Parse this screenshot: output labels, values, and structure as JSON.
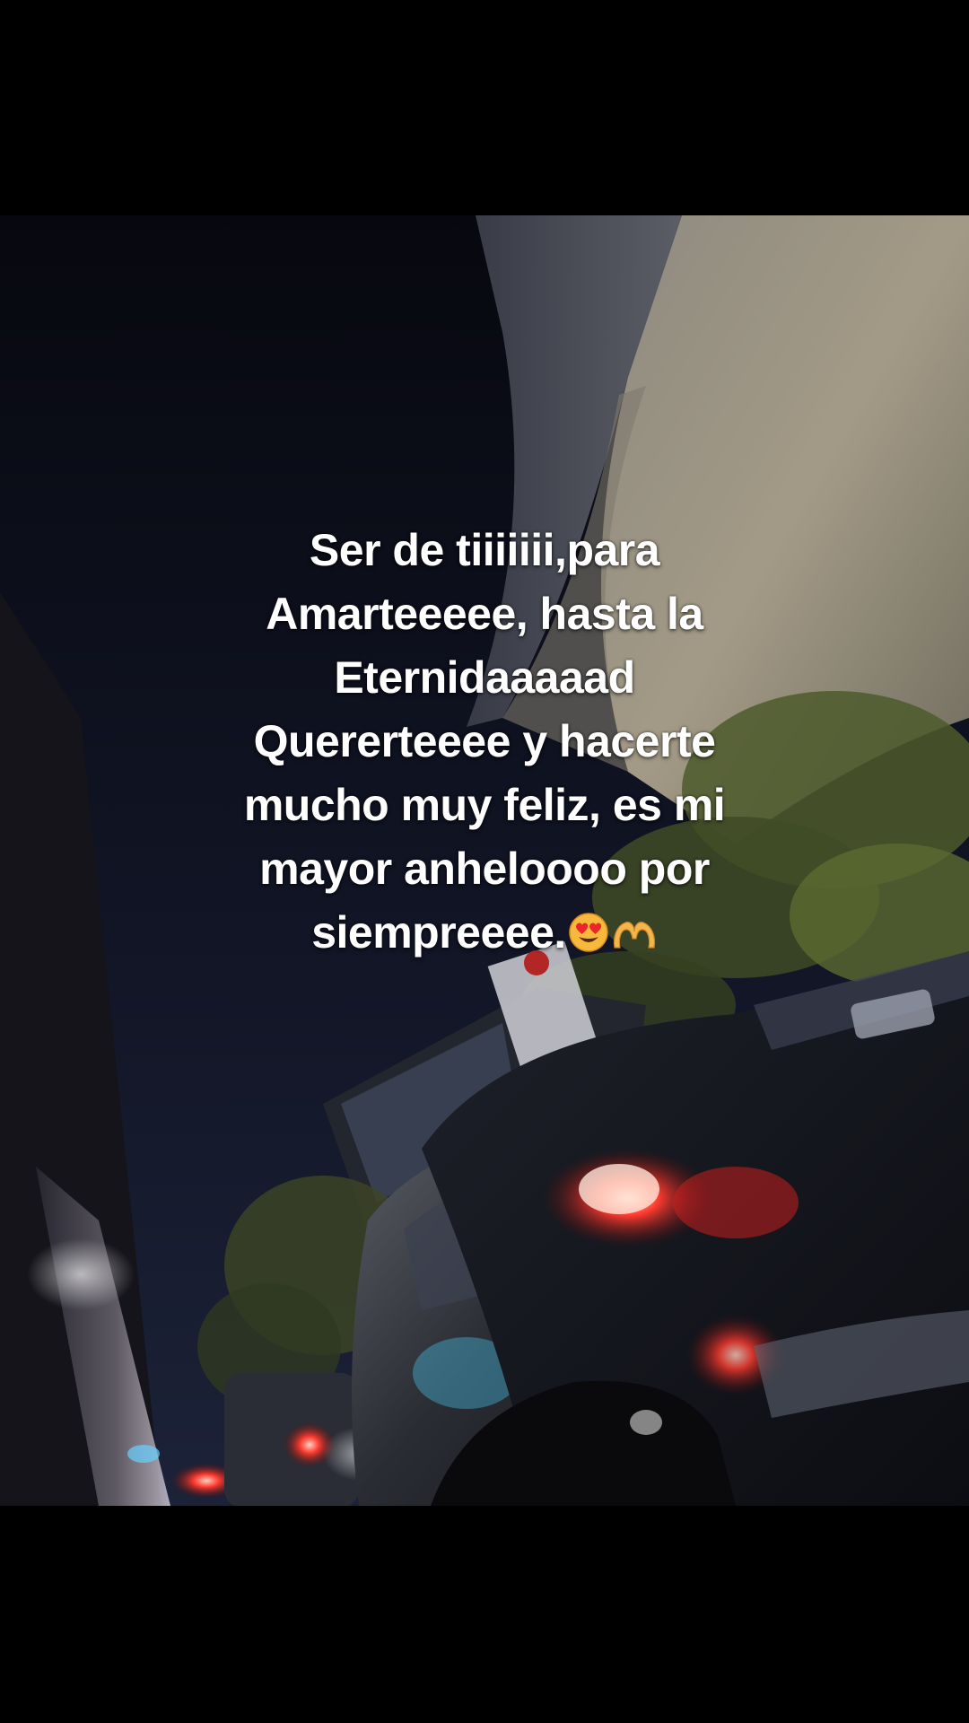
{
  "caption": {
    "lines": [
      "Ser de tiiiiiii,para",
      "Amarteeeee, hasta la",
      "Eternidaaaaad",
      "Quererteeee y hacerte",
      "mucho muy feliz, es mi",
      "mayor anheloooo por",
      "siempreeee."
    ],
    "emojis": [
      "heart-eyes-emoji",
      "heart-hands-emoji"
    ]
  },
  "scene": {
    "description_icons": [
      "night-traffic-photo"
    ]
  },
  "colors": {
    "background": "#000000",
    "caption_text": "#ffffff",
    "sky": "#0b0d16",
    "taillight": "#ff2a2a"
  }
}
